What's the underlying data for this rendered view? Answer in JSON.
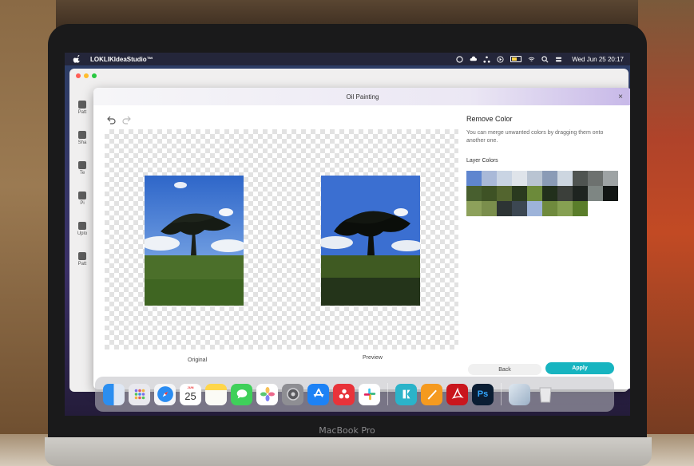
{
  "menubar": {
    "app_name": "LOKLIKIdeaStudio™",
    "datetime": "Wed Jun 25  20:17"
  },
  "dialog": {
    "title": "Oil Painting",
    "close_label": "×",
    "caption_original": "Original",
    "caption_preview": "Preview"
  },
  "panel": {
    "title": "Remove Color",
    "description": "You can merge unwanted colors by dragging them onto another one.",
    "layer_colors_label": "Layer Colors",
    "swatches": [
      "#5f86cf",
      "#a9b9d8",
      "#c9d4e3",
      "#dfe4ea",
      "#b9c4d2",
      "#8a9bb6",
      "#cdd6e0",
      "#4f5451",
      "#6d716f",
      "#9ea3a4",
      "#485f2f",
      "#3e5225",
      "#53652f",
      "#2a3a1f",
      "#6c8a3a",
      "#22301c",
      "#3b3f3a",
      "#1e2420",
      "#7e8683",
      "#121614",
      "#8da15b",
      "#7a8e4c",
      "#2d3434",
      "#3c4752",
      "#9db3d9",
      "#6f8a3d",
      "#86a052",
      "#5a7d2a"
    ]
  },
  "buttons": {
    "back": "Back",
    "apply": "Apply"
  },
  "behind_tools": [
    "Patt",
    "Sha",
    "Te",
    "Pi",
    "Uplo",
    "Patt"
  ],
  "dock": {
    "calendar_month": "JUN",
    "calendar_day": "25",
    "icons": [
      "finder-icon",
      "launchpad-icon",
      "safari-icon",
      "calendar-icon",
      "notes-icon",
      "messages-icon",
      "photos-icon",
      "system-settings-icon",
      "app-store-icon",
      "creative-cloud-icon",
      "slack-icon",
      "app-icon",
      "pages-icon",
      "acrobat-icon",
      "photoshop-icon",
      "preview-icon",
      "trash-icon"
    ],
    "photoshop_label": "Ps"
  },
  "laptop": {
    "brand": "MacBook Pro"
  }
}
